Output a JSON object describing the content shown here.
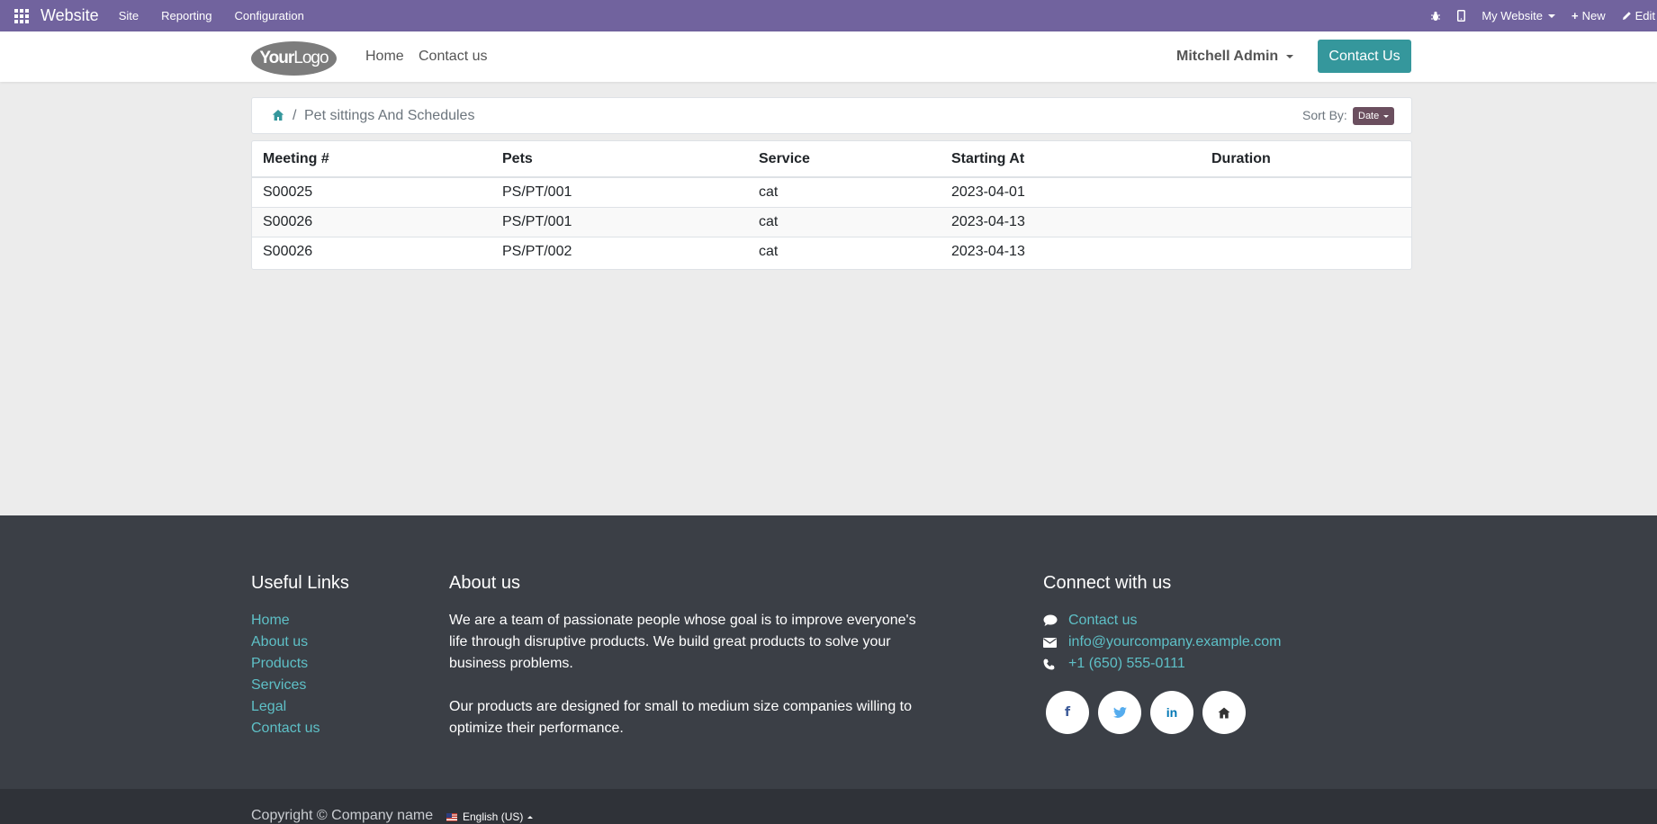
{
  "admin_bar": {
    "brand": "Website",
    "menus": [
      "Site",
      "Reporting",
      "Configuration"
    ],
    "website_selector": "My Website",
    "new_label": "New",
    "edit_label": "Edit"
  },
  "header": {
    "logo_text_bold": "Your",
    "logo_text_light": "Logo",
    "nav": [
      "Home",
      "Contact us"
    ],
    "user": "Mitchell Admin",
    "cta": "Contact Us"
  },
  "breadcrumb": {
    "current": "Pet sittings And Schedules",
    "separator": "/",
    "sort_label": "Sort By:",
    "sort_value": "Date"
  },
  "table": {
    "columns": [
      "Meeting #",
      "Pets",
      "Service",
      "Starting At",
      "Duration"
    ],
    "rows": [
      [
        "S00025",
        "PS/PT/001",
        "cat",
        "2023-04-01",
        ""
      ],
      [
        "S00026",
        "PS/PT/001",
        "cat",
        "2023-04-13",
        ""
      ],
      [
        "S00026",
        "PS/PT/002",
        "cat",
        "2023-04-13",
        ""
      ]
    ]
  },
  "footer": {
    "useful_links_title": "Useful Links",
    "useful_links": [
      "Home",
      "About us",
      "Products",
      "Services",
      "Legal",
      "Contact us"
    ],
    "about_title": "About us",
    "about_p1": "We are a team of passionate people whose goal is to improve everyone's life through disruptive products. We build great products to solve your business problems.",
    "about_p2": "Our products are designed for small to medium size companies willing to optimize their performance.",
    "connect_title": "Connect with us",
    "contact_link": "Contact us",
    "email": "info@yourcompany.example.com",
    "phone": "+1 (650) 555-0111",
    "social_icons": [
      "facebook-icon",
      "twitter-icon",
      "linkedin-icon",
      "home-icon"
    ]
  },
  "copyright": {
    "text": "Copyright © Company name",
    "language": "English (US)"
  },
  "colors": {
    "admin_bar": "#71639e",
    "primary": "#35979c",
    "footer": "#3b3f46",
    "link": "#5ec0c7",
    "sort_badge": "#6b4f5f"
  }
}
